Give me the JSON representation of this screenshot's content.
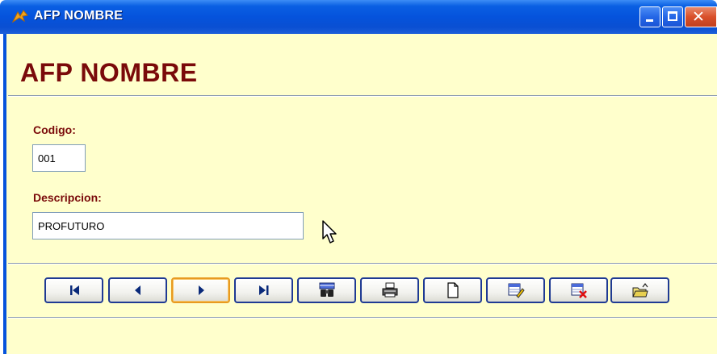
{
  "window": {
    "title": "AFP  NOMBRE",
    "controls": {
      "minimize": "minimize",
      "maximize": "maximize",
      "close": "close"
    }
  },
  "form": {
    "heading": "AFP  NOMBRE",
    "codigo_label": "Codigo:",
    "codigo_value": "001",
    "descripcion_label": "Descripcion:",
    "descripcion_value": "PROFUTURO"
  },
  "toolbar": {
    "buttons": [
      {
        "name": "first-record-button",
        "icon": "first-icon"
      },
      {
        "name": "previous-record-button",
        "icon": "previous-icon"
      },
      {
        "name": "next-record-button",
        "icon": "next-icon",
        "focused": true
      },
      {
        "name": "last-record-button",
        "icon": "last-icon"
      },
      {
        "name": "find-button",
        "icon": "binoculars-icon"
      },
      {
        "name": "print-button",
        "icon": "printer-icon"
      },
      {
        "name": "new-button",
        "icon": "blank-page-icon"
      },
      {
        "name": "edit-button",
        "icon": "edit-record-icon"
      },
      {
        "name": "delete-button",
        "icon": "delete-record-icon"
      },
      {
        "name": "exit-button",
        "icon": "open-folder-icon"
      }
    ]
  },
  "colors": {
    "background": "#ffffcc",
    "title_bar": "#0553dc",
    "heading_text": "#7a0a0a",
    "button_border": "#1f3a93",
    "focused_border": "#e89a20"
  }
}
